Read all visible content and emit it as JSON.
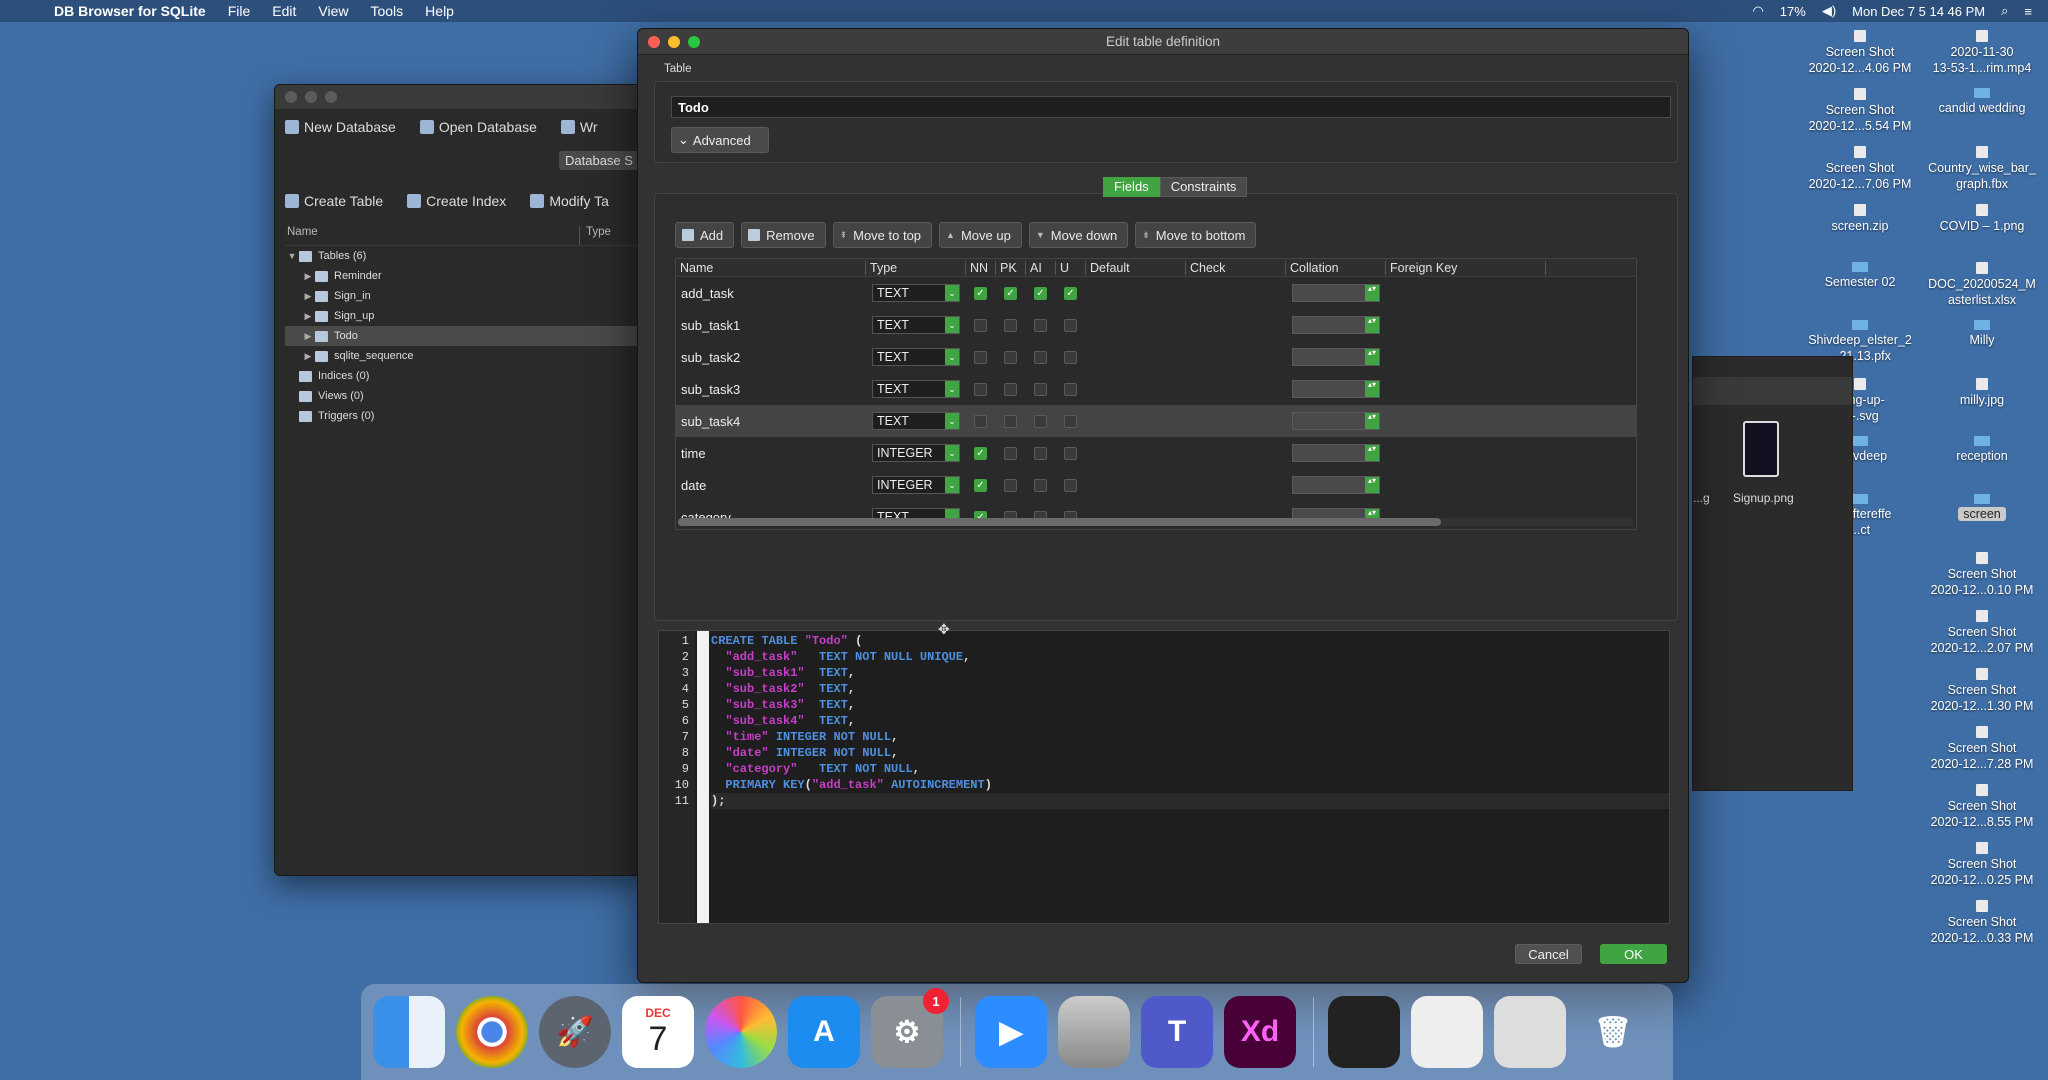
{
  "menubar": {
    "app_name": "DB Browser for SQLite",
    "menus": [
      "File",
      "Edit",
      "View",
      "Tools",
      "Help"
    ],
    "status": {
      "battery": "17%",
      "clock": "Mon Dec 7  5 14 46 PM"
    }
  },
  "main_window": {
    "toolbar1": [
      "New Database",
      "Open Database",
      "Wr"
    ],
    "tab_label": "Database S",
    "toolbar2": [
      "Create Table",
      "Create Index",
      "Modify Ta"
    ],
    "tree_headers": [
      "Name",
      "Type"
    ],
    "tree_items": [
      {
        "label": "Tables (6)",
        "level": 0,
        "expanded": true
      },
      {
        "label": "Reminder",
        "level": 1
      },
      {
        "label": "Sign_in",
        "level": 1
      },
      {
        "label": "Sign_up",
        "level": 1
      },
      {
        "label": "Todo",
        "level": 1,
        "selected": true
      },
      {
        "label": "sqlite_sequence",
        "level": 1
      },
      {
        "label": "Indices (0)",
        "level": 0
      },
      {
        "label": "Views (0)",
        "level": 0
      },
      {
        "label": "Triggers (0)",
        "level": 0
      }
    ]
  },
  "dialog": {
    "title": "Edit table definition",
    "table_group_label": "Table",
    "table_name": "Todo",
    "advanced_label": "Advanced",
    "tabs": {
      "fields": "Fields",
      "constraints": "Constraints"
    },
    "buttons": {
      "add": "Add",
      "remove": "Remove",
      "move_top": "Move to top",
      "move_up": "Move up",
      "move_down": "Move down",
      "move_bottom": "Move to bottom"
    },
    "columns": [
      "Name",
      "Type",
      "NN",
      "PK",
      "AI",
      "U",
      "Default",
      "Check",
      "Collation",
      "Foreign Key"
    ],
    "fields": [
      {
        "name": "add_task",
        "type": "TEXT",
        "nn": true,
        "pk": true,
        "ai": true,
        "u": true
      },
      {
        "name": "sub_task1",
        "type": "TEXT",
        "nn": false,
        "pk": false,
        "ai": false,
        "u": false
      },
      {
        "name": "sub_task2",
        "type": "TEXT",
        "nn": false,
        "pk": false,
        "ai": false,
        "u": false
      },
      {
        "name": "sub_task3",
        "type": "TEXT",
        "nn": false,
        "pk": false,
        "ai": false,
        "u": false
      },
      {
        "name": "sub_task4",
        "type": "TEXT",
        "nn": false,
        "pk": false,
        "ai": false,
        "u": false,
        "selected": true
      },
      {
        "name": "time",
        "type": "INTEGER",
        "nn": true,
        "pk": false,
        "ai": false,
        "u": false
      },
      {
        "name": "date",
        "type": "INTEGER",
        "nn": true,
        "pk": false,
        "ai": false,
        "u": false
      },
      {
        "name": "category",
        "type": "TEXT",
        "nn": true,
        "pk": false,
        "ai": false,
        "u": false
      }
    ],
    "sql_lines": [
      "CREATE TABLE \"Todo\" (",
      "  \"add_task\"   TEXT NOT NULL UNIQUE,",
      "  \"sub_task1\"  TEXT,",
      "  \"sub_task2\"  TEXT,",
      "  \"sub_task3\"  TEXT,",
      "  \"sub_task4\"  TEXT,",
      "  \"time\" INTEGER NOT NULL,",
      "  \"date\" INTEGER NOT NULL,",
      "  \"category\"   TEXT NOT NULL,",
      "  PRIMARY KEY(\"add_task\" AUTOINCREMENT)",
      ");"
    ],
    "cancel_label": "Cancel",
    "ok_label": "OK"
  },
  "desktop_icons_col1": [
    "Screen Shot\n2020-12...4.06 PM",
    "Screen Shot\n2020-12...5.54 PM",
    "Screen Shot\n2020-12...7.06 PM",
    "screen.zip",
    "Semester 02",
    "Shivdeep_elster_2\n...21.13.pfx",
    "...ing-up-\n...-.svg",
    "...hivdeep",
    "..._aftereffe\n...ct"
  ],
  "desktop_icons_col2": [
    "2020-11-30\n13-53-1...rim.mp4",
    "candid wedding",
    "Country_wise_bar_\ngraph.fbx",
    "COVID – 1.png",
    "DOC_20200524_M\nasterlist.xlsx",
    "Milly",
    "milly.jpg",
    "reception",
    "screen",
    "Screen Shot\n2020-12...0.10 PM",
    "Screen Shot\n2020-12...2.07 PM",
    "Screen Shot\n2020-12...1.30 PM",
    "Screen Shot\n2020-12...7.28 PM",
    "Screen Shot\n2020-12...8.55 PM",
    "Screen Shot\n2020-12...0.25 PM",
    "Screen Shot\n2020-12...0.33 PM"
  ],
  "finder_peek": {
    "file1": "...g",
    "file2": "Signup.png"
  },
  "dock": {
    "calendar_month": "DEC",
    "calendar_day": "7",
    "settings_badge": "1",
    "xd_label": "Xd"
  }
}
